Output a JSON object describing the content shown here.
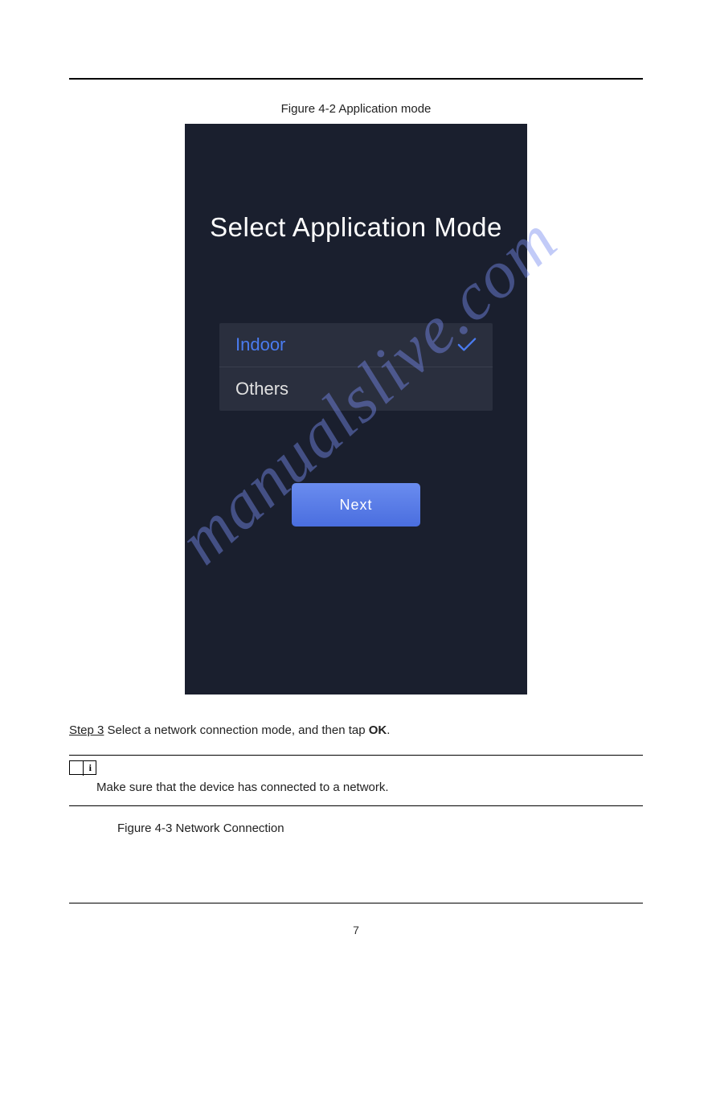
{
  "figure_caption": "Figure 4-2 Application mode",
  "device_screen": {
    "title": "Select Application Mode",
    "options": [
      {
        "label": "Indoor",
        "selected": true
      },
      {
        "label": "Others",
        "selected": false
      }
    ],
    "next_button": "Next"
  },
  "watermark": "manualslive.com",
  "step": {
    "prefix": "Step 3",
    "text": "Select a network connection mode, and then tap",
    "action": "OK",
    "suffix": "."
  },
  "note": {
    "text": "Make sure that the device has connected to a network."
  },
  "figure_ref": {
    "text": "Figure 4-3 Network Connection"
  },
  "page_number": "7"
}
